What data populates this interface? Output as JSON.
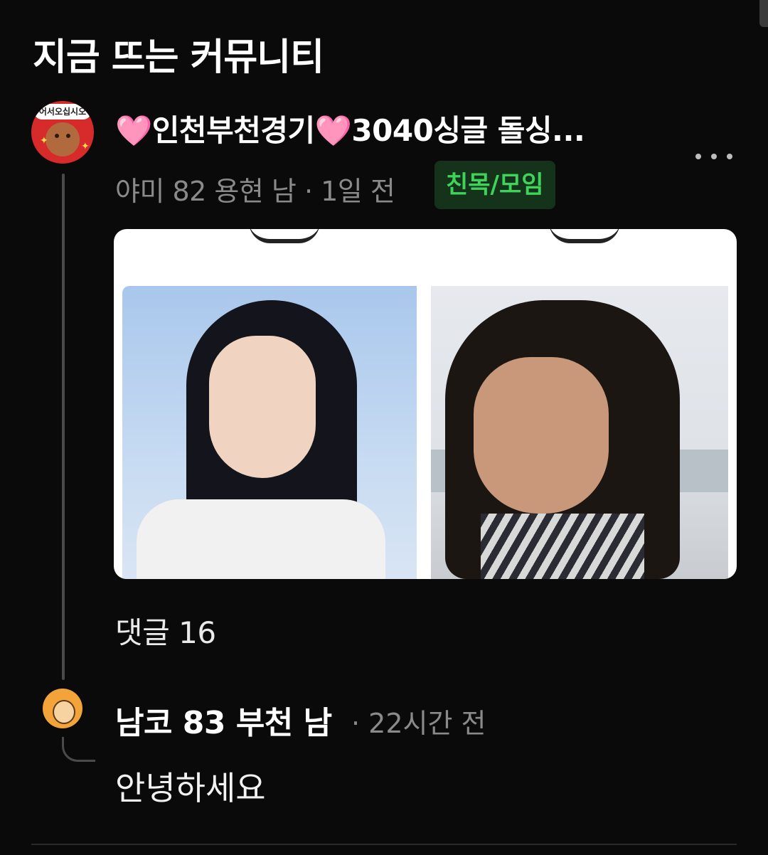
{
  "section": {
    "title": "지금 뜨는 커뮤니티"
  },
  "post": {
    "author_avatar_text": "어서오십시오",
    "title": "🩷인천부천경기🩷3040싱글 돌싱...",
    "meta": "야미 82 용현 남 · 1일 전",
    "category": "친목/모임",
    "comment_count": "댓글 16"
  },
  "reply": {
    "author": "남코 83 부천 남",
    "time": "· 22시간 전",
    "text": "안녕하세요"
  },
  "colors": {
    "background": "#0a0a0a",
    "category_bg": "#14331a",
    "category_text": "#3ed35a",
    "meta_text": "#8a8a8a"
  }
}
